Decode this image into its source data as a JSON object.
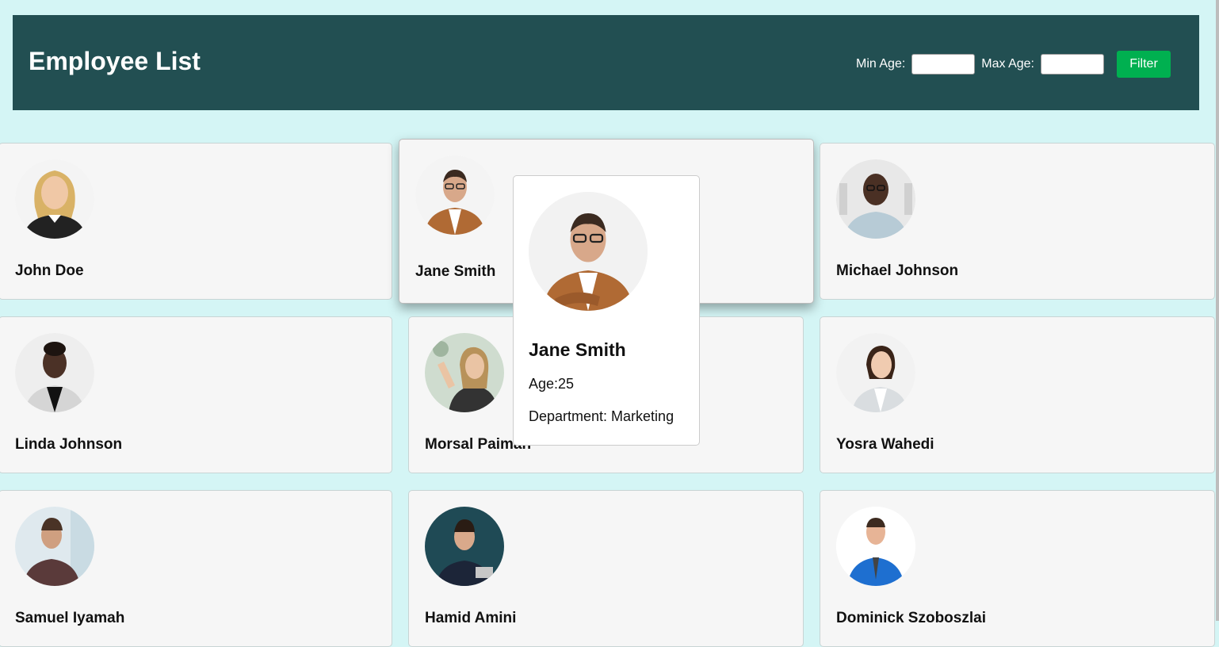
{
  "header": {
    "title": "Employee List",
    "min_age_label": "Min Age:",
    "min_age_value": "",
    "max_age_label": "Max Age:",
    "max_age_value": "",
    "filter_button": "Filter"
  },
  "employees": [
    {
      "name": "John Doe"
    },
    {
      "name": "Jane Smith"
    },
    {
      "name": "Michael Johnson"
    },
    {
      "name": "Linda Johnson"
    },
    {
      "name": "Morsal Paiman"
    },
    {
      "name": "Yosra Wahedi"
    },
    {
      "name": "Samuel Iyamah"
    },
    {
      "name": "Hamid Amini"
    },
    {
      "name": "Dominick Szoboszlai"
    }
  ],
  "tooltip": {
    "name": "Jane Smith",
    "age": "Age:25",
    "department": "Department: Marketing"
  },
  "colors": {
    "page_bg": "#d4f5f5",
    "header_bg": "#224f52",
    "button_bg": "#00b050",
    "card_bg": "#f6f6f6"
  }
}
